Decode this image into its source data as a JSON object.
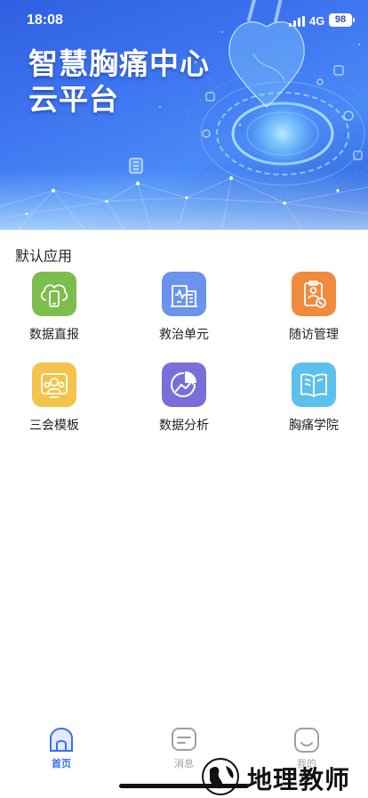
{
  "status_bar": {
    "time": "18:08",
    "network": "4G",
    "battery": "98"
  },
  "hero": {
    "title_line1": "智慧胸痛中心",
    "title_line2": "云平台"
  },
  "section": {
    "title": "默认应用"
  },
  "apps": [
    {
      "label": "数据直报",
      "icon": "cloud-phone-icon",
      "color": "#7cbd4c"
    },
    {
      "label": "救治单元",
      "icon": "hospital-heartbeat-icon",
      "color": "#6b93ee"
    },
    {
      "label": "随访管理",
      "icon": "clipboard-phone-icon",
      "color": "#f08a3c"
    },
    {
      "label": "三会模板",
      "icon": "meeting-group-icon",
      "color": "#f3c449"
    },
    {
      "label": "数据分析",
      "icon": "analytics-chart-icon",
      "color": "#7a6fd8"
    },
    {
      "label": "胸痛学院",
      "icon": "open-book-icon",
      "color": "#5cc0ec"
    }
  ],
  "tabbar": {
    "home": "首页",
    "messages": "消息",
    "mine": "我的",
    "active_color": "#3b6ff0",
    "inactive_color": "#9aa0aa"
  },
  "watermark": {
    "text": "地理教师"
  }
}
